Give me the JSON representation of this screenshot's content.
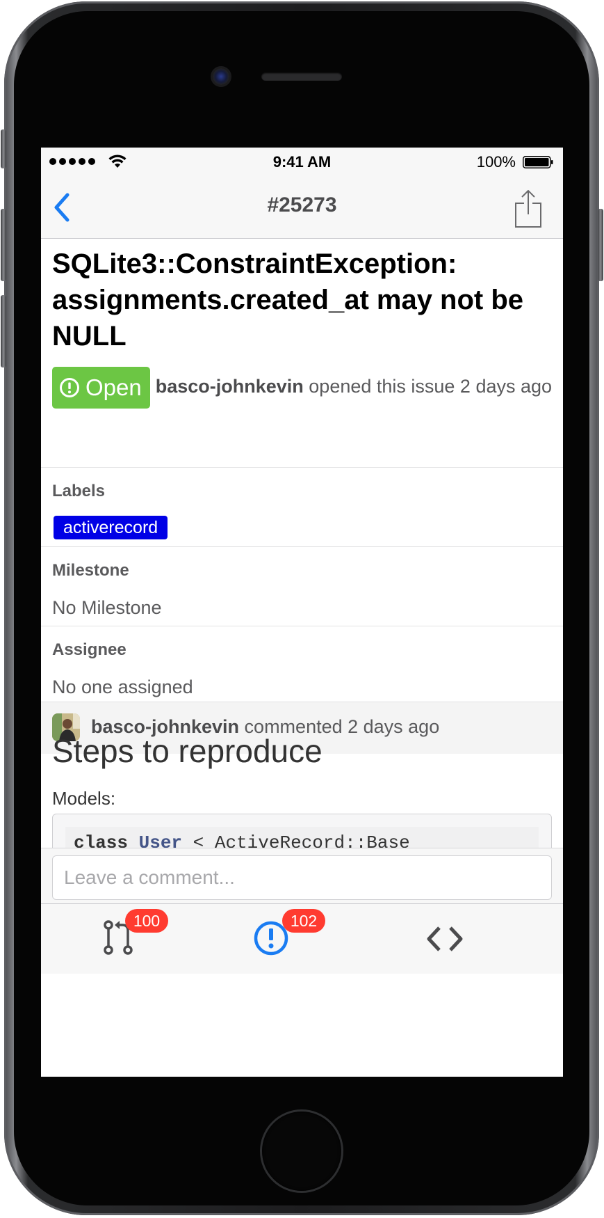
{
  "status_bar": {
    "time": "9:41 AM",
    "battery_percent": "100%",
    "battery_level": 1.0,
    "signal_bars": 5
  },
  "nav": {
    "title": "#25273",
    "back_icon": "chevron-left-icon",
    "share_icon": "share-icon"
  },
  "issue": {
    "title": "SQLite3::ConstraintException: assignments.created_at may not be NULL",
    "state": "Open",
    "state_color": "#6cc644",
    "author": "basco-johnkevin",
    "opened_text": " opened this issue 2 days ago"
  },
  "labels": {
    "heading": "Labels",
    "items": [
      {
        "name": "activerecord",
        "color": "#0000e6"
      }
    ]
  },
  "milestone": {
    "heading": "Milestone",
    "value": "No Milestone"
  },
  "assignee": {
    "heading": "Assignee",
    "value": "No one assigned"
  },
  "comment": {
    "author": "basco-johnkevin",
    "meta_text": " commented 2 days ago",
    "heading": "Steps to reproduce",
    "paragraph": "Models:",
    "code_keyword": "class",
    "code_class": "User",
    "code_rest": " < ActiveRecord::Base"
  },
  "comment_input": {
    "placeholder": "Leave a comment..."
  },
  "tabs": [
    {
      "name": "pull-requests",
      "icon": "pull-request-icon",
      "badge": "100",
      "active": false
    },
    {
      "name": "issues",
      "icon": "issue-icon",
      "badge": "102",
      "active": true
    },
    {
      "name": "code",
      "icon": "code-icon",
      "badge": "",
      "active": false
    }
  ],
  "colors": {
    "accent": "#1a7cf2",
    "badge": "#ff3b30"
  }
}
